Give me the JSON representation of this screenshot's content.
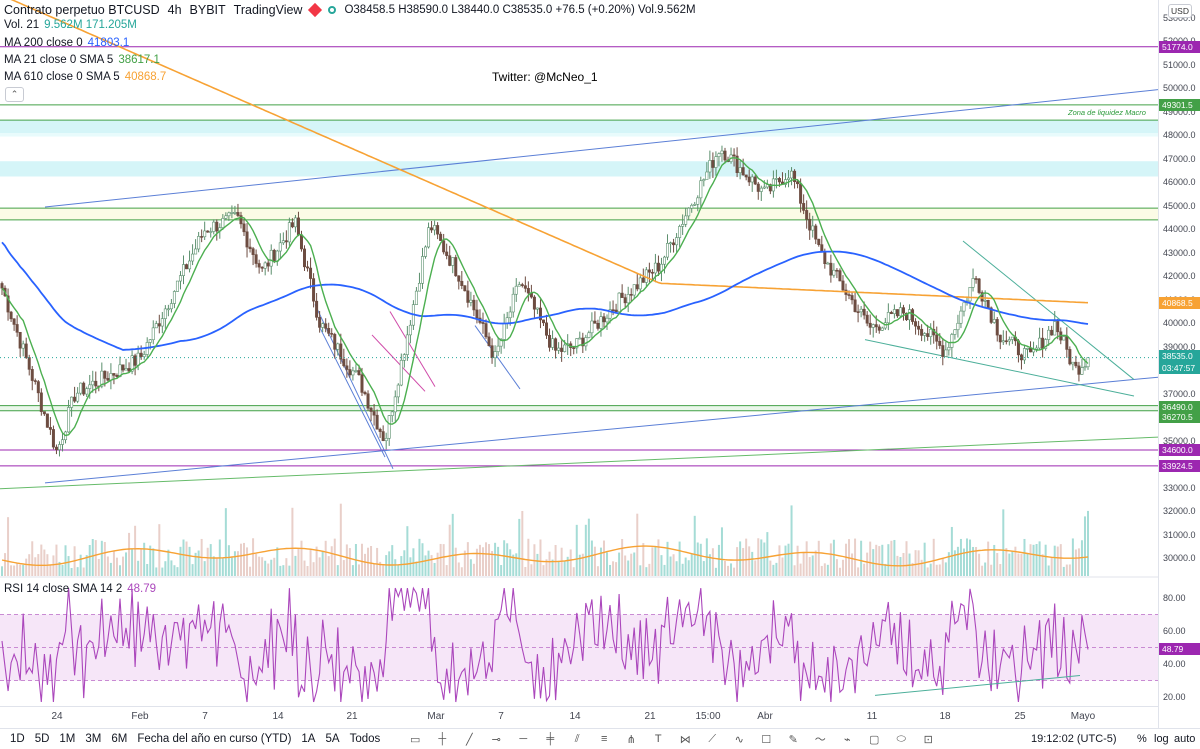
{
  "header": {
    "symbol": "Contrato perpetuo BTCUSD",
    "interval": "4h",
    "exchange": "BYBIT",
    "source": "TradingView",
    "open": "O38458.5",
    "high": "H38590.0",
    "low": "L38440.0",
    "close": "C38535.0",
    "change": "+76.5 (+0.20%)",
    "volume": "Vol.9.562M"
  },
  "indicators": [
    {
      "label": "Vol. 21",
      "values": "9.562M  171.205M",
      "color": "#26a69a"
    },
    {
      "label": "MA 200 close 0",
      "values": "41803.1",
      "color": "#2962ff"
    },
    {
      "label": "MA 21 close 0 SMA 5",
      "values": "38617.1",
      "color": "#4caf50"
    },
    {
      "label": "MA 610 close 0 SMA 5",
      "values": "40868.7",
      "color": "#f7a234"
    }
  ],
  "annotations": {
    "twitter": "Twitter: @McNeo_1",
    "zona": "Zona de liquidez Macro"
  },
  "price_axis": {
    "currency_button": "USD",
    "ticks": [
      "53000.0",
      "52000.0",
      "51000.0",
      "50000.0",
      "49000.0",
      "48000.0",
      "47000.0",
      "46000.0",
      "45000.0",
      "44000.0",
      "43000.0",
      "42000.0",
      "41000.0",
      "40000.0",
      "39000.0",
      "38000.0",
      "37000.0",
      "36000.0",
      "35000.0",
      "34000.0",
      "33000.0",
      "32000.0",
      "31000.0",
      "30000.0"
    ],
    "rsi_ticks": [
      "80.00",
      "60.00",
      "40.00",
      "20.00"
    ],
    "badges": [
      {
        "label": "51774.0",
        "color": "#9c27b0"
      },
      {
        "label": "49301.5",
        "color": "#43a047"
      },
      {
        "label": "40868.5",
        "color": "#f7a234"
      },
      {
        "label": "38535.0",
        "color": "#26a69a"
      },
      {
        "label": "03:47:57",
        "color": "#26a69a"
      },
      {
        "label": "36490.0",
        "color": "#43a047"
      },
      {
        "label": "36270.5",
        "color": "#43a047"
      },
      {
        "label": "34600.0",
        "color": "#9c27b0"
      },
      {
        "label": "33924.5",
        "color": "#9c27b0"
      },
      {
        "label": "48.79",
        "color": "#9c27b0"
      }
    ]
  },
  "rsi": {
    "label": "RSI 14 close SMA 14 2",
    "value": "48.79",
    "color": "#ab47bc"
  },
  "time_axis": [
    "24",
    "Feb",
    "7",
    "14",
    "21",
    "Mar",
    "7",
    "14",
    "21",
    "15:00",
    "Abr",
    "11",
    "18",
    "25",
    "Mayo"
  ],
  "toolbar": {
    "timeframes": [
      "1D",
      "5D",
      "1M",
      "3M",
      "6M",
      "Fecha del año en curso (YTD)",
      "1A",
      "5A",
      "Todos"
    ],
    "tools": [
      "calendar-icon",
      "crosshair-icon",
      "trendline-icon",
      "horizontal-ray-icon",
      "horizontal-line-icon",
      "vertical-line-icon",
      "channel-icon",
      "fib-icon",
      "pitchfork-icon",
      "text-icon",
      "pattern-icon",
      "xabcd-icon",
      "elliott-icon",
      "projection-icon",
      "brush-icon",
      "wave-icon",
      "path-icon",
      "rectangle-icon",
      "ellipse-icon",
      "polyline-icon"
    ],
    "clock": "19:12:02 (UTC-5)",
    "percent": "%",
    "log": "log",
    "auto": "auto"
  },
  "colors": {
    "up_candle": "#26a69a",
    "down_candle": "#6d4c41",
    "ma200": "#2962ff",
    "ma21": "#4caf50",
    "ma610": "#f7a234",
    "trend_blue": "#5b7fd6",
    "rsi_line": "#ab47bc"
  },
  "chart_data": {
    "type": "candlestick",
    "title": "Contrato perpetuo BTCUSD · 4h · BYBIT",
    "ylim": [
      29500,
      53500
    ],
    "price_keypoints": [
      {
        "x": "Ene 20",
        "y": 41500
      },
      {
        "x": "Ene 22",
        "y": 38000
      },
      {
        "x": "Ene 24",
        "y": 34500
      },
      {
        "x": "Ene 26",
        "y": 37000
      },
      {
        "x": "Feb 1",
        "y": 38500
      },
      {
        "x": "Feb 7",
        "y": 44000
      },
      {
        "x": "Feb 10",
        "y": 44500
      },
      {
        "x": "Feb 12",
        "y": 42200
      },
      {
        "x": "Feb 15",
        "y": 44300
      },
      {
        "x": "Feb 18",
        "y": 40000
      },
      {
        "x": "Feb 22",
        "y": 37500
      },
      {
        "x": "Feb 24",
        "y": 35000
      },
      {
        "x": "Mar 1",
        "y": 44200
      },
      {
        "x": "Mar 3",
        "y": 42000
      },
      {
        "x": "Mar 6",
        "y": 38500
      },
      {
        "x": "Mar 9",
        "y": 41800
      },
      {
        "x": "Mar 12",
        "y": 38800
      },
      {
        "x": "Mar 15",
        "y": 39000
      },
      {
        "x": "Mar 18",
        "y": 41000
      },
      {
        "x": "Mar 23",
        "y": 42500
      },
      {
        "x": "Mar 28",
        "y": 47500
      },
      {
        "x": "Abr 1",
        "y": 45500
      },
      {
        "x": "Abr 5",
        "y": 46500
      },
      {
        "x": "Abr 8",
        "y": 43000
      },
      {
        "x": "Abr 11",
        "y": 39800
      },
      {
        "x": "Abr 14",
        "y": 40500
      },
      {
        "x": "Abr 18",
        "y": 38800
      },
      {
        "x": "Abr 21",
        "y": 42000
      },
      {
        "x": "Abr 24",
        "y": 39500
      },
      {
        "x": "Abr 27",
        "y": 38500
      },
      {
        "x": "Abr 30",
        "y": 40000
      },
      {
        "x": "May 2",
        "y": 38000
      },
      {
        "x": "May 3",
        "y": 38535
      }
    ],
    "horizontal_levels": [
      51774.0,
      49301.5,
      36490.0,
      36270.5,
      34600.0,
      33924.5
    ],
    "rsi_ylim": [
      15,
      88
    ],
    "rsi_levels": [
      70,
      50,
      30
    ],
    "rsi_last": 48.79
  }
}
